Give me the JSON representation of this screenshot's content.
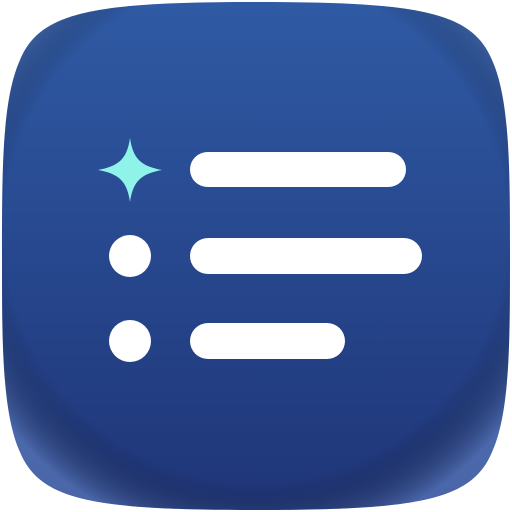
{
  "icon": {
    "name": "bulleted-list-with-sparkle-app-icon",
    "colors": {
      "background_top": "#2f5aa4",
      "background_bottom": "#1f3578",
      "edge_glow": "#6d8ed0",
      "sparkle": "#8ff3ea",
      "bullet": "#ffffff",
      "line": "#ffffff"
    },
    "rows": [
      {
        "marker": "sparkle-icon",
        "line_length_fraction": 0.93
      },
      {
        "marker": "bullet-dot",
        "line_length_fraction": 1.0
      },
      {
        "marker": "bullet-dot",
        "line_length_fraction": 0.67
      }
    ]
  }
}
